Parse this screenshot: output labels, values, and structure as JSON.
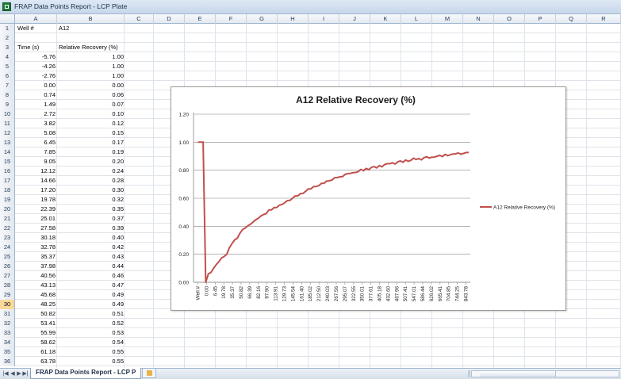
{
  "window": {
    "title": "FRAP Data Points Report - LCP Plate"
  },
  "columns": [
    "A",
    "B",
    "C",
    "D",
    "E",
    "F",
    "G",
    "H",
    "I",
    "J",
    "K",
    "L",
    "M",
    "N",
    "O",
    "P",
    "Q",
    "R"
  ],
  "selected_row": "30",
  "rows": [
    {
      "num": "1",
      "a": "Well #",
      "b": "A12"
    },
    {
      "num": "2",
      "a": "",
      "b": ""
    },
    {
      "num": "3",
      "a": "Time (s)",
      "b": "Relative Recovery (%)"
    },
    {
      "num": "4",
      "a": "-5.76",
      "b": "1.00"
    },
    {
      "num": "5",
      "a": "-4.26",
      "b": "1.00"
    },
    {
      "num": "6",
      "a": "-2.76",
      "b": "1.00"
    },
    {
      "num": "7",
      "a": "0.00",
      "b": "0.00"
    },
    {
      "num": "8",
      "a": "0.74",
      "b": "0.06"
    },
    {
      "num": "9",
      "a": "1.49",
      "b": "0.07"
    },
    {
      "num": "10",
      "a": "2.72",
      "b": "0.10"
    },
    {
      "num": "11",
      "a": "3.82",
      "b": "0.12"
    },
    {
      "num": "12",
      "a": "5.08",
      "b": "0.15"
    },
    {
      "num": "13",
      "a": "6.45",
      "b": "0.17"
    },
    {
      "num": "14",
      "a": "7.85",
      "b": "0.19"
    },
    {
      "num": "15",
      "a": "9.05",
      "b": "0.20"
    },
    {
      "num": "16",
      "a": "12.12",
      "b": "0.24"
    },
    {
      "num": "17",
      "a": "14.66",
      "b": "0.28"
    },
    {
      "num": "18",
      "a": "17.20",
      "b": "0.30"
    },
    {
      "num": "19",
      "a": "19.78",
      "b": "0.32"
    },
    {
      "num": "20",
      "a": "22.39",
      "b": "0.35"
    },
    {
      "num": "21",
      "a": "25.01",
      "b": "0.37"
    },
    {
      "num": "22",
      "a": "27.58",
      "b": "0.39"
    },
    {
      "num": "23",
      "a": "30.18",
      "b": "0.40"
    },
    {
      "num": "24",
      "a": "32.78",
      "b": "0.42"
    },
    {
      "num": "25",
      "a": "35.37",
      "b": "0.43"
    },
    {
      "num": "26",
      "a": "37.98",
      "b": "0.44"
    },
    {
      "num": "27",
      "a": "40.56",
      "b": "0.46"
    },
    {
      "num": "28",
      "a": "43.13",
      "b": "0.47"
    },
    {
      "num": "29",
      "a": "45.68",
      "b": "0.49"
    },
    {
      "num": "30",
      "a": "48.25",
      "b": "0.49"
    },
    {
      "num": "31",
      "a": "50.82",
      "b": "0.51"
    },
    {
      "num": "32",
      "a": "53.41",
      "b": "0.52"
    },
    {
      "num": "33",
      "a": "55.99",
      "b": "0.53"
    },
    {
      "num": "34",
      "a": "58.62",
      "b": "0.54"
    },
    {
      "num": "35",
      "a": "61.18",
      "b": "0.55"
    },
    {
      "num": "36",
      "a": "63.78",
      "b": "0.55"
    }
  ],
  "sheet_tab": {
    "label": "FRAP Data Points Report - LCP P"
  },
  "chart_data": {
    "type": "line",
    "title": "A12 Relative Recovery (%)",
    "series": [
      {
        "name": "A12 Relative Recovery (%)",
        "color": "#c0504d"
      }
    ],
    "x_tick_labels": [
      "Well #",
      "0.00",
      "6.45",
      "19.78",
      "35.37",
      "50.82",
      "66.39",
      "82.16",
      "97.90",
      "113.91",
      "129.73",
      "145.54",
      "161.40",
      "185.02",
      "212.50",
      "240.03",
      "267.56",
      "295.07",
      "322.55",
      "350.01",
      "377.61",
      "405.18",
      "432.60",
      "467.96",
      "507.41",
      "547.01",
      "586.44",
      "626.02",
      "665.41",
      "704.85",
      "744.25",
      "843.78"
    ],
    "y_tick_labels": [
      "0.00",
      "0.20",
      "0.40",
      "0.60",
      "0.80",
      "1.00",
      "1.20"
    ],
    "ylim": [
      0,
      1.2
    ],
    "legend_position": "right",
    "grid": true,
    "points": [
      1.0,
      1.0,
      1.0,
      0.0,
      0.06,
      0.07,
      0.1,
      0.12,
      0.15,
      0.17,
      0.19,
      0.2,
      0.24,
      0.28,
      0.3,
      0.32,
      0.35,
      0.37,
      0.39,
      0.4,
      0.42,
      0.43,
      0.44,
      0.46,
      0.47,
      0.49,
      0.49,
      0.51,
      0.52,
      0.53,
      0.54,
      0.55,
      0.55,
      0.57,
      0.58,
      0.59,
      0.6,
      0.61,
      0.62,
      0.63,
      0.64,
      0.65,
      0.66,
      0.67,
      0.68,
      0.69,
      0.69,
      0.7,
      0.71,
      0.72,
      0.73,
      0.73,
      0.74,
      0.75,
      0.75,
      0.76,
      0.77,
      0.77,
      0.78,
      0.78,
      0.79,
      0.79,
      0.8,
      0.8,
      0.81,
      0.81,
      0.82,
      0.82,
      0.82,
      0.83,
      0.83,
      0.84,
      0.84,
      0.85,
      0.85,
      0.85,
      0.86,
      0.86,
      0.86,
      0.87,
      0.87,
      0.87,
      0.88,
      0.88,
      0.88,
      0.88,
      0.89,
      0.89,
      0.89,
      0.89,
      0.9,
      0.9,
      0.9,
      0.9,
      0.91,
      0.91,
      0.91,
      0.91,
      0.92,
      0.92,
      0.92,
      0.92,
      0.92,
      0.93
    ]
  }
}
